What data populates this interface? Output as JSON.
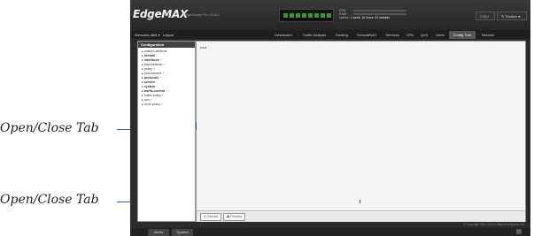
{
  "callouts": {
    "top": "Open/Close Tab",
    "bottom": "Open/Close Tab"
  },
  "header": {
    "logo": "EdgeMAX",
    "model": "EdgeRouter Pro v1.8.0",
    "cpu_label": "CPU:",
    "ram_label": "RAM:",
    "uptime_label": "Uptime:",
    "uptime_value": "1 week, 16 hours, 32 minutes",
    "cli_button": "CLI",
    "toolbox_button": "Toolbox"
  },
  "nav": {
    "welcome": "Welcome ubnt",
    "logout": "Logout",
    "tabs": [
      {
        "label": "Dashboard"
      },
      {
        "label": "Traffic Analysis"
      },
      {
        "label": "Routing"
      },
      {
        "label": "Firewall/NAT"
      },
      {
        "label": "Services"
      },
      {
        "label": "VPN"
      },
      {
        "label": "QoS"
      },
      {
        "label": "Users"
      },
      {
        "label": "Config Tree"
      },
      {
        "label": "Wizards"
      }
    ],
    "active_tab": "Config Tree"
  },
  "sidebar": {
    "title": "Configuration",
    "items": [
      {
        "label": "custom-attribute"
      },
      {
        "label": "firewall",
        "bold": true
      },
      {
        "label": "interfaces",
        "bold": true
      },
      {
        "label": "load-balance"
      },
      {
        "label": "policy"
      },
      {
        "label": "port-forward"
      },
      {
        "label": "protocols",
        "bold": true
      },
      {
        "label": "service",
        "bold": true
      },
      {
        "label": "system",
        "bold": true
      },
      {
        "label": "traffic-control",
        "bold": true
      },
      {
        "label": "traffic-policy"
      },
      {
        "label": "vpn"
      },
      {
        "label": "zone-policy"
      }
    ]
  },
  "main": {
    "root_label": "root",
    "discard_button": "Discard",
    "preview_button": "Preview"
  },
  "footer": {
    "copyright": "© Copyright 2012-2014 Ubiquiti Networks, Inc.",
    "tabs": [
      {
        "label": "Alerts"
      },
      {
        "label": "System"
      }
    ]
  },
  "colors": {
    "leader": "#2a6fb2",
    "topbar": "#2b2b2b",
    "port_active": "#3c8f3c"
  }
}
